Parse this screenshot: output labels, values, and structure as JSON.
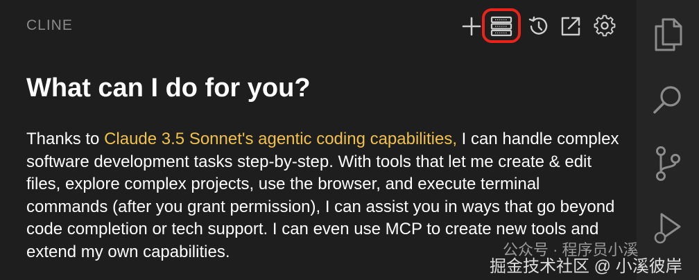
{
  "panel": {
    "title": "CLINE",
    "toolbar": {
      "new_task_icon": "plus-icon",
      "mcp_servers_icon": "server-stack-icon",
      "history_icon": "history-icon",
      "popout_icon": "external-link-icon",
      "settings_icon": "gear-icon",
      "highlight_color": "#e8241c"
    }
  },
  "welcome": {
    "heading": "What can I do for you?",
    "text_before": "Thanks to ",
    "link_text": "Claude 3.5 Sonnet's agentic coding capabilities,",
    "text_after": " I can handle complex software development tasks step-by-step. With tools that let me create & edit files, explore complex projects, use the browser, and execute terminal commands (after you grant permission), I can assist you in ways that go beyond code completion or tech support. I can even use MCP to create new tools and extend my own capabilities.",
    "accent_color": "#f0c14b"
  },
  "activity_bar": {
    "items": [
      {
        "icon": "files-icon"
      },
      {
        "icon": "search-icon"
      },
      {
        "icon": "source-control-icon"
      },
      {
        "icon": "run-debug-icon"
      }
    ]
  },
  "watermark": {
    "line1": "公众号 · 程序员小溪",
    "line2": "掘金技术社区 @ 小溪彼岸"
  }
}
